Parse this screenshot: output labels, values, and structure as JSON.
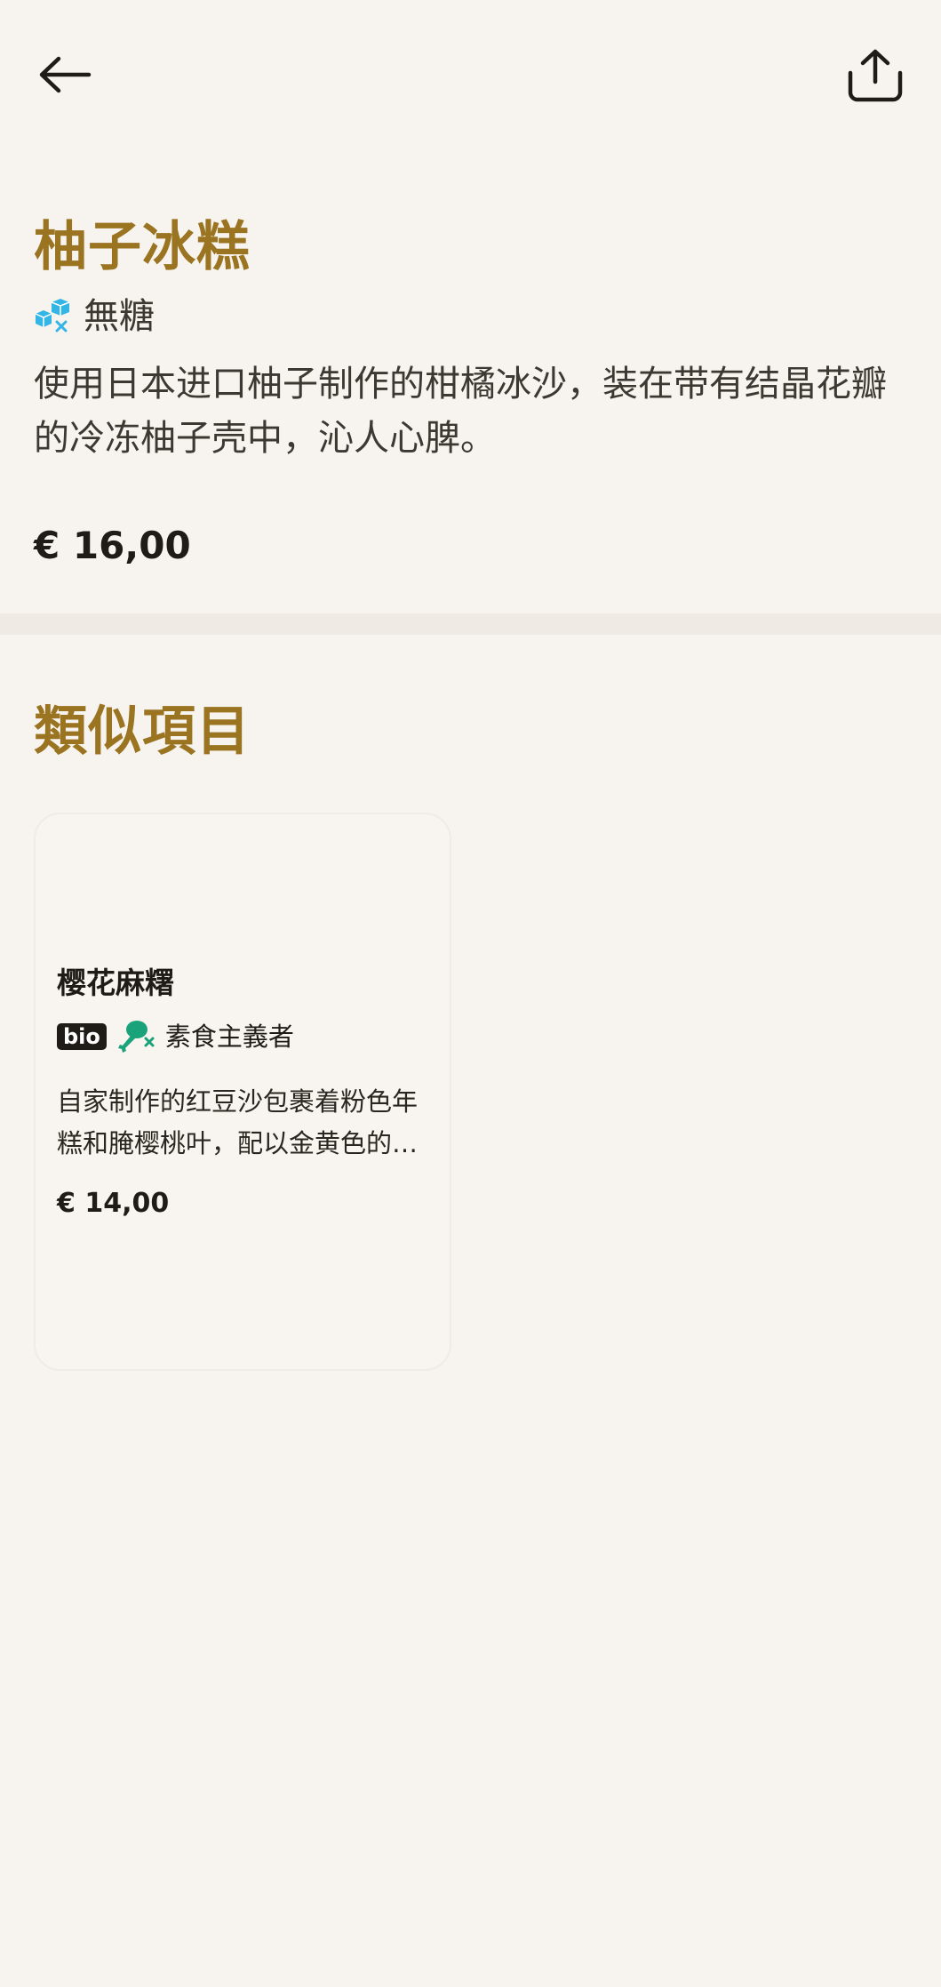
{
  "toolbar": {
    "back_icon": "arrow-left-icon",
    "share_icon": "share-icon"
  },
  "product": {
    "title": "柚子冰糕",
    "tag": {
      "icon": "sugar-free-icon",
      "label": "無糖"
    },
    "description": "使用日本进口柚子制作的柑橘冰沙，装在带有结晶花瓣的冷冻柚子壳中，沁人心脾。",
    "price": "€ 16,00"
  },
  "similar": {
    "title": "類似項目",
    "items": [
      {
        "name": "樱花麻糬",
        "badge": "bio",
        "tag": {
          "icon": "vegan-icon",
          "label": "素食主義者"
        },
        "description": "自家制作的红豆沙包裹着粉色年糕和腌樱桃叶，配以金黄色的…",
        "price": "€ 14,00"
      }
    ]
  },
  "colors": {
    "background": "#f7f4ef",
    "accent": "#9b7421",
    "text": "#1f1b16",
    "sugar_free_icon": "#33b5e5",
    "vegan_icon": "#1aa37a"
  }
}
